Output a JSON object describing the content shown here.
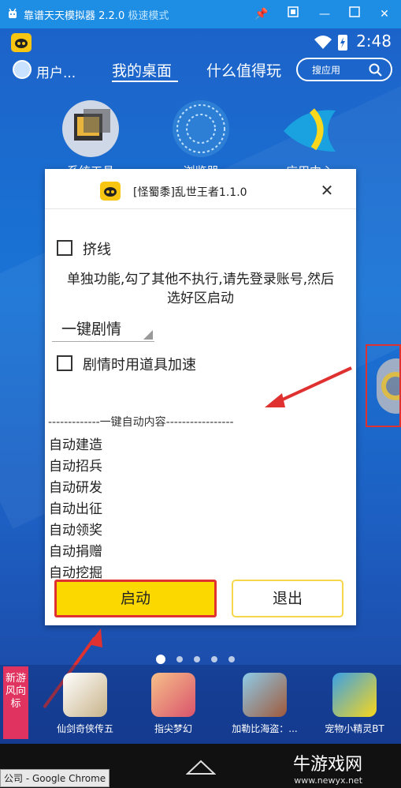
{
  "titlebar": {
    "title": "靠谱天天模拟器 2.2.0",
    "mode": "极速模式",
    "buttons": [
      "pin-icon",
      "restore-icon",
      "minimize-icon",
      "maximize-icon",
      "close-icon"
    ]
  },
  "statusbar": {
    "time": "2:48"
  },
  "topnav": {
    "user": "用户...",
    "tab_desk": "我的桌面",
    "tab_worth": "什么值得玩",
    "search_placeholder": "搜应用"
  },
  "desktop_icons": [
    {
      "label": "系统工具",
      "icon": "system-tools-icon"
    },
    {
      "label": "浏览器",
      "icon": "browser-icon"
    },
    {
      "label": "应用中心",
      "icon": "app-center-icon"
    }
  ],
  "dialog": {
    "title": "[怪蜀黍]乱世王者1.1.0",
    "checkbox_squeeze": "挤线",
    "note_line1": "单独功能,勾了其他不执行,请先登录账号,然后",
    "note_line2": "选好区启动",
    "select_value": "一键剧情",
    "checkbox_props": "剧情时用道具加速",
    "separator": "-------------一键自动内容-----------------",
    "features": [
      "自动建造",
      "自动招兵",
      "自动研发",
      "自动出征",
      "自动领奖",
      "自动捐赠",
      "自动挖掘"
    ],
    "start_label": "启动",
    "exit_label": "退出"
  },
  "dock": {
    "tag": "新游风向标",
    "games": [
      "仙剑奇侠传五",
      "指尖梦幻",
      "加勒比海盗：...",
      "宠物小精灵BT"
    ]
  },
  "chrome_tab": "公司 - Google Chrome",
  "watermark": {
    "text": "牛游戏网",
    "site": "www.newyx.net"
  },
  "colors": {
    "accent": "#1e8de4",
    "start_button": "#fbd800",
    "highlight": "#e03131"
  }
}
